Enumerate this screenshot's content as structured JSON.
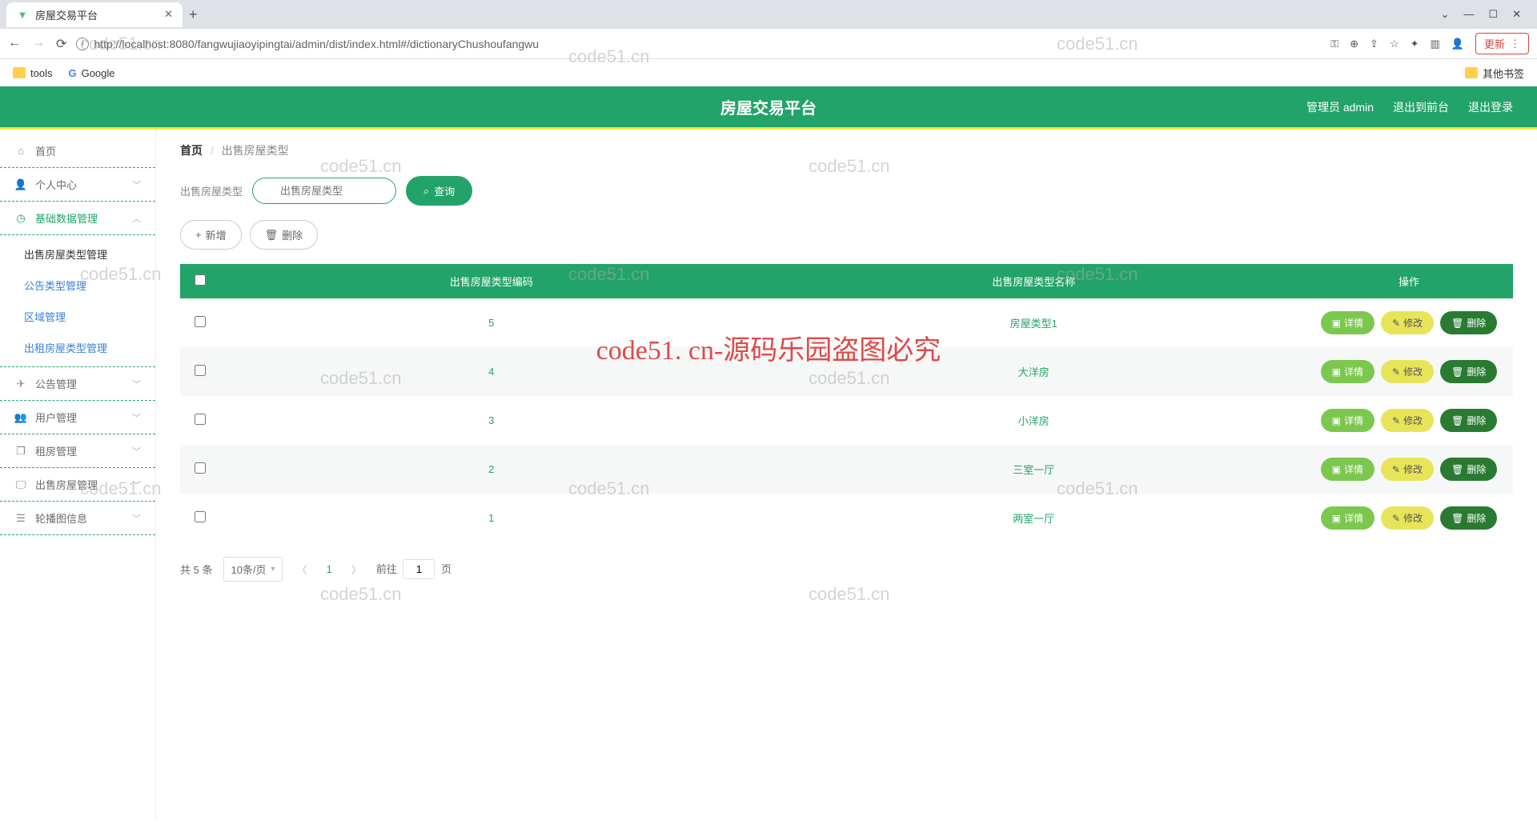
{
  "browser": {
    "tab_title": "房屋交易平台",
    "url": "http://localhost:8080/fangwujiaoyipingtai/admin/dist/index.html#/dictionaryChushoufangwu",
    "update_label": "更新",
    "bookmarks": {
      "tools": "tools",
      "google": "Google",
      "other": "其他书签"
    }
  },
  "header": {
    "title": "房屋交易平台",
    "user": "管理员 admin",
    "to_front": "退出到前台",
    "logout": "退出登录"
  },
  "sidebar": {
    "home": "首页",
    "personal": "个人中心",
    "base_data": "基础数据管理",
    "sub": {
      "sale_type": "出售房屋类型管理",
      "notice_type": "公告类型管理",
      "area": "区域管理",
      "rent_type": "出租房屋类型管理"
    },
    "notice": "公告管理",
    "user": "用户管理",
    "rent": "租房管理",
    "sale": "出售房屋管理",
    "carousel": "轮播图信息"
  },
  "breadcrumb": {
    "home": "首页",
    "current": "出售房屋类型"
  },
  "search": {
    "label": "出售房屋类型",
    "placeholder": "出售房屋类型",
    "query": "查询"
  },
  "actions": {
    "add": "新增",
    "delete": "删除"
  },
  "table": {
    "headers": {
      "code": "出售房屋类型编码",
      "name": "出售房屋类型名称",
      "ops": "操作"
    },
    "ops": {
      "detail": "详情",
      "edit": "修改",
      "del": "删除"
    },
    "rows": [
      {
        "code": "5",
        "name": "房屋类型1"
      },
      {
        "code": "4",
        "name": "大洋房"
      },
      {
        "code": "3",
        "name": "小洋房"
      },
      {
        "code": "2",
        "name": "三室一厅"
      },
      {
        "code": "1",
        "name": "两室一厅"
      }
    ]
  },
  "pagination": {
    "total": "共 5 条",
    "page_size": "10条/页",
    "current": "1",
    "goto_prefix": "前往",
    "goto_suffix": "页",
    "goto_value": "1"
  },
  "watermark": {
    "small": "code51.cn",
    "big": "code51. cn-源码乐园盗图必究"
  }
}
